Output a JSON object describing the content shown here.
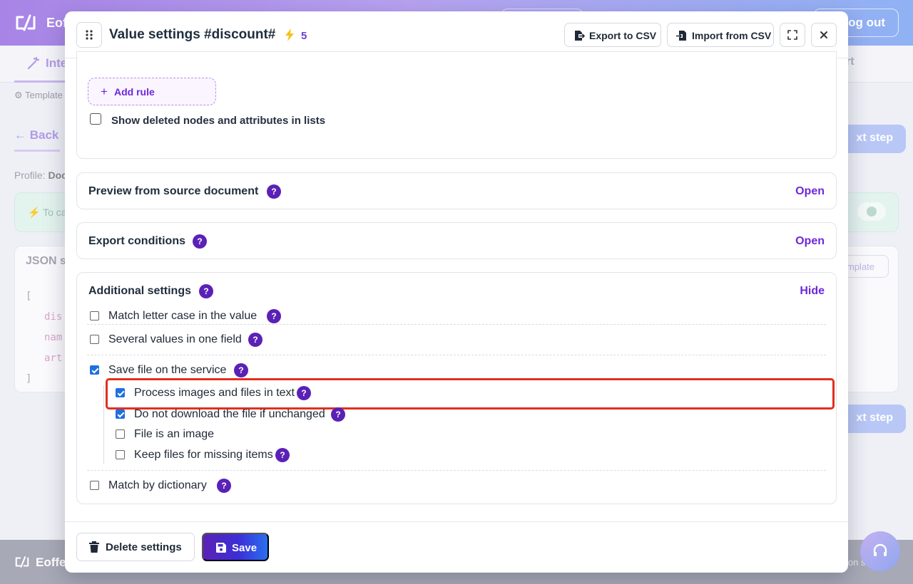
{
  "background": {
    "brand": "Eoff",
    "logout_label": "Log out",
    "active_tab": "Inte",
    "right_tab": "rt",
    "templates_label": "Template",
    "back_label": "Back",
    "profile_label": "Profile:",
    "profile_value": "Doc",
    "next_step_label": "xt step",
    "banner_text": "To ca",
    "json_title": "JSON s",
    "code_lines": [
      "[",
      "dis",
      "nam",
      "art",
      "]"
    ],
    "template_button": "mplate",
    "footer_brand": "Eoffe",
    "footer_right": "ion    s"
  },
  "modal": {
    "title": "Value settings #discount#",
    "bolt_count": "5",
    "export_label": "Export to CSV",
    "import_label": "Import from CSV",
    "add_rule_label": "Add rule",
    "show_deleted_label": "Show deleted nodes and attributes in lists",
    "show_deleted_checked": false,
    "sections": {
      "preview": {
        "title": "Preview from source document",
        "action": "Open"
      },
      "export_conditions": {
        "title": "Export conditions",
        "action": "Open"
      },
      "additional": {
        "title": "Additional settings",
        "action": "Hide"
      }
    },
    "options": {
      "match_case": {
        "label": "Match letter case in the value",
        "checked": false
      },
      "several_values": {
        "label": "Several values in one field",
        "checked": false
      },
      "save_file": {
        "label": "Save file on the service",
        "checked": true
      },
      "process_images": {
        "label": "Process images and files in text",
        "checked": true
      },
      "no_download": {
        "label": "Do not download the file if unchanged",
        "checked": true
      },
      "is_image": {
        "label": "File is an image",
        "checked": false
      },
      "keep_files": {
        "label": "Keep files for missing items",
        "checked": false
      },
      "dictionary": {
        "label": "Match by dictionary",
        "checked": false
      }
    },
    "help_glyph": "?",
    "delete_label": "Delete settings",
    "save_label": "Save"
  },
  "colors": {
    "accent": "#6d28d9",
    "help_badge": "#5b21b6",
    "checkbox_on": "#1f6fe0",
    "highlight": "#e0301e"
  },
  "icons": [
    "drag-handle-icon",
    "bolt-icon",
    "export-icon",
    "import-icon",
    "expand-icon",
    "close-icon",
    "plus-icon",
    "trash-icon",
    "save-disk-icon",
    "help-icon",
    "headset-icon"
  ]
}
